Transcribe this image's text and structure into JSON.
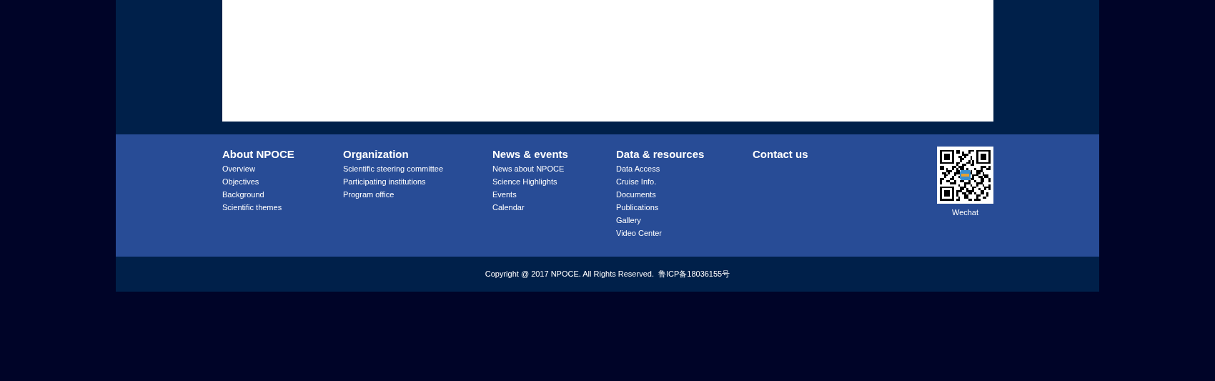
{
  "footer": {
    "columns": [
      {
        "heading": "About NPOCE",
        "links": [
          "Overview",
          "Objectives",
          "Background",
          "Scientific themes"
        ]
      },
      {
        "heading": "Organization",
        "links": [
          "Scientific steering committee",
          "Participating institutions",
          "Program office"
        ]
      },
      {
        "heading": "News & events",
        "links": [
          "News about NPOCE",
          "Science Highlights",
          "Events",
          "Calendar"
        ]
      },
      {
        "heading": "Data & resources",
        "links": [
          "Data Access",
          "Cruise Info.",
          "Documents",
          "Publications",
          "Gallery",
          "Video Center"
        ]
      },
      {
        "heading": "Contact us"
      }
    ],
    "qr_caption": "Wechat"
  },
  "copyright": {
    "text": "Copyright @ 2017 NPOCE. All Rights Reserved.",
    "icp_link": "鲁ICP备18036155号"
  }
}
